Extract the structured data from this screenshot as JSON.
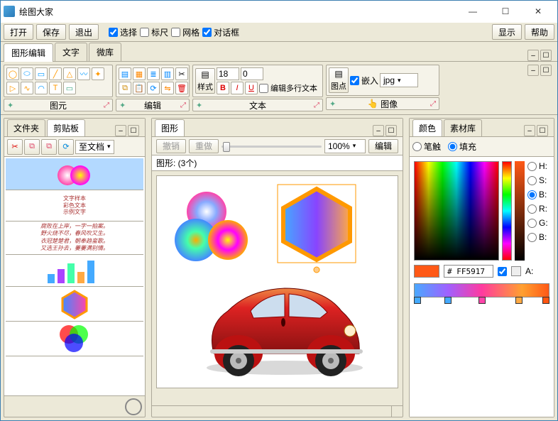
{
  "app": {
    "title": "绘图大家"
  },
  "menu": {
    "open": "打开",
    "save": "保存",
    "exit": "退出",
    "select": "选择",
    "ruler": "标尺",
    "grid": "网格",
    "dialog": "对话框",
    "show": "显示",
    "help": "帮助"
  },
  "tabs": {
    "shape_edit": "图形编辑",
    "text": "文字",
    "micro": "微库"
  },
  "ribbon": {
    "element": "图元",
    "edit": "编辑",
    "text": "文本",
    "image": "图像",
    "style": "样式",
    "anchor": "图点",
    "embed": "嵌入",
    "multiline": "编辑多行文本",
    "img_fmt": "jpg",
    "font_size": "18",
    "line_spacing": "0",
    "bold": "B",
    "italic": "I",
    "underline": "U"
  },
  "left": {
    "tabs": {
      "folder": "文件夹",
      "clipboard": "剪贴板"
    },
    "toolbar": {
      "cut": "✂",
      "to_doc": "至文档"
    }
  },
  "mid": {
    "title": "图形",
    "undo": "撤销",
    "redo": "重做",
    "zoom": "100%",
    "edit": "编辑",
    "count_label": "图形: (3个)"
  },
  "right": {
    "tabs": {
      "color": "颜色",
      "material": "素材库"
    },
    "brush": "笔触",
    "fill": "填充",
    "hsb_r": {
      "H": "H:",
      "S": "S:",
      "B": "B:",
      "R": "R:",
      "G": "G:",
      "Bl": "B:"
    },
    "alpha": "A:",
    "hex": "# FF5917"
  },
  "colors": {
    "accent": "#FF5917"
  }
}
